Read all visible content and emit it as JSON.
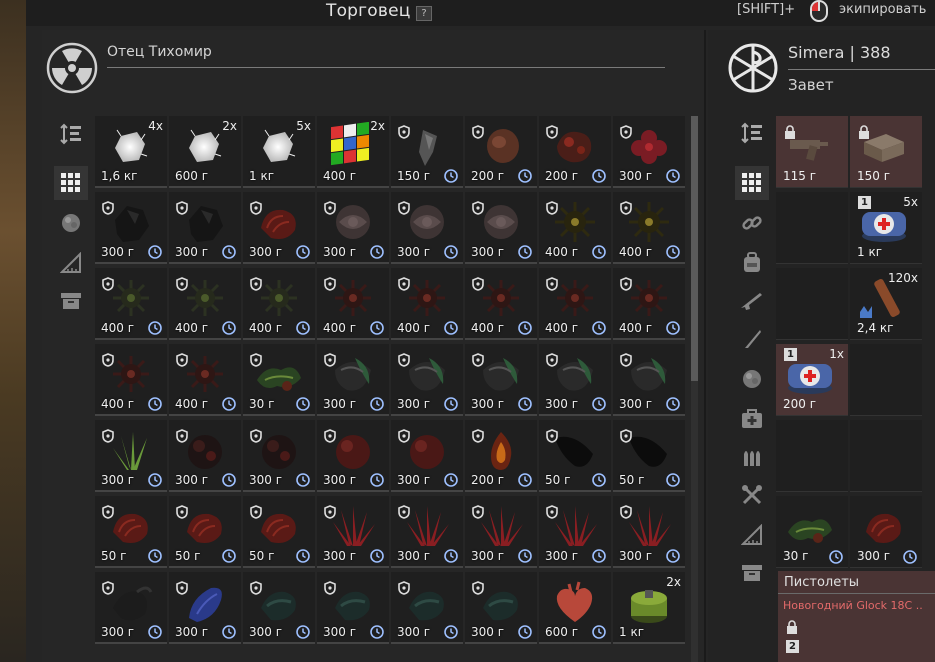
{
  "window": {
    "title": "Торговец",
    "help": "?",
    "hint_key": "[SHIFT]+",
    "hint_action": "экипировать"
  },
  "trader": {
    "name": "Отец Тихомир",
    "icon": "radiation-icon"
  },
  "player": {
    "name": "Simera | 388",
    "faction": "Завет",
    "icon": "faction-emblem-icon"
  },
  "left_tabs": [
    {
      "name": "sort-icon",
      "active": false
    },
    {
      "name": "grid-icon",
      "active": true
    },
    {
      "name": "artifact-icon",
      "active": false
    },
    {
      "name": "ruler-icon",
      "active": false
    },
    {
      "name": "box-icon",
      "active": false
    }
  ],
  "right_tabs": [
    {
      "name": "sort-icon",
      "active": false
    },
    {
      "name": "grid-icon",
      "active": true
    },
    {
      "name": "link-icon",
      "active": false
    },
    {
      "name": "backpack-icon",
      "active": false
    },
    {
      "name": "rifle-icon",
      "active": false
    },
    {
      "name": "knife-icon",
      "active": false
    },
    {
      "name": "artifact-icon",
      "active": false
    },
    {
      "name": "medkit-icon",
      "active": false
    },
    {
      "name": "ammo-icon",
      "active": false
    },
    {
      "name": "tools-icon",
      "active": false
    },
    {
      "name": "ruler-icon",
      "active": false
    },
    {
      "name": "box-icon",
      "active": false
    }
  ],
  "trader_items": [
    [
      {
        "kind": "crystal-white",
        "qty": "4x",
        "weight": "1,6 кг",
        "shield": false,
        "clock": false
      },
      {
        "kind": "crystal-white",
        "qty": "2x",
        "weight": "600 г",
        "shield": false,
        "clock": false
      },
      {
        "kind": "crystal-white",
        "qty": "5x",
        "weight": "1 кг",
        "shield": false,
        "clock": false
      },
      {
        "kind": "rubik-cube",
        "qty": "2x",
        "weight": "400 г",
        "shield": false,
        "clock": false
      },
      {
        "kind": "gray-shard",
        "qty": "",
        "weight": "150 г",
        "shield": true,
        "clock": true
      },
      {
        "kind": "brown-lump",
        "qty": "",
        "weight": "200 г",
        "shield": true,
        "clock": true
      },
      {
        "kind": "red-lump",
        "qty": "",
        "weight": "200 г",
        "shield": true,
        "clock": true
      },
      {
        "kind": "red-flower",
        "qty": "",
        "weight": "300 г",
        "shield": true,
        "clock": true
      }
    ],
    [
      {
        "kind": "black-rock",
        "qty": "",
        "weight": "300 г",
        "shield": true,
        "clock": true
      },
      {
        "kind": "black-rock",
        "qty": "",
        "weight": "300 г",
        "shield": true,
        "clock": true
      },
      {
        "kind": "red-shell",
        "qty": "",
        "weight": "300 г",
        "shield": true,
        "clock": true
      },
      {
        "kind": "gray-rose",
        "qty": "",
        "weight": "300 г",
        "shield": true,
        "clock": true
      },
      {
        "kind": "gray-rose",
        "qty": "",
        "weight": "300 г",
        "shield": true,
        "clock": true
      },
      {
        "kind": "gray-rose",
        "qty": "",
        "weight": "300 г",
        "shield": true,
        "clock": true
      },
      {
        "kind": "spiky-mine",
        "qty": "",
        "weight": "400 г",
        "shield": true,
        "clock": true
      },
      {
        "kind": "spiky-mine",
        "qty": "",
        "weight": "400 г",
        "shield": true,
        "clock": true
      }
    ],
    [
      {
        "kind": "spiky-green",
        "qty": "",
        "weight": "400 г",
        "shield": true,
        "clock": true
      },
      {
        "kind": "spiky-green",
        "qty": "",
        "weight": "400 г",
        "shield": true,
        "clock": true
      },
      {
        "kind": "spiky-green",
        "qty": "",
        "weight": "400 г",
        "shield": true,
        "clock": true
      },
      {
        "kind": "spiky-red",
        "qty": "",
        "weight": "400 г",
        "shield": true,
        "clock": true
      },
      {
        "kind": "spiky-red",
        "qty": "",
        "weight": "400 г",
        "shield": true,
        "clock": true
      },
      {
        "kind": "spiky-red",
        "qty": "",
        "weight": "400 г",
        "shield": true,
        "clock": true
      },
      {
        "kind": "spiky-red",
        "qty": "",
        "weight": "400 г",
        "shield": true,
        "clock": true
      },
      {
        "kind": "spiky-red",
        "qty": "",
        "weight": "400 г",
        "shield": true,
        "clock": true
      }
    ],
    [
      {
        "kind": "spiky-red",
        "qty": "",
        "weight": "400 г",
        "shield": true,
        "clock": true
      },
      {
        "kind": "spiky-red",
        "qty": "",
        "weight": "400 г",
        "shield": true,
        "clock": true
      },
      {
        "kind": "green-leaf",
        "qty": "",
        "weight": "30 г",
        "shield": true,
        "clock": true
      },
      {
        "kind": "green-shell",
        "qty": "",
        "weight": "300 г",
        "shield": true,
        "clock": true
      },
      {
        "kind": "green-shell",
        "qty": "",
        "weight": "300 г",
        "shield": true,
        "clock": true
      },
      {
        "kind": "green-shell",
        "qty": "",
        "weight": "300 г",
        "shield": true,
        "clock": true
      },
      {
        "kind": "green-shell",
        "qty": "",
        "weight": "300 г",
        "shield": true,
        "clock": true
      },
      {
        "kind": "green-shell",
        "qty": "",
        "weight": "300 г",
        "shield": true,
        "clock": true
      }
    ],
    [
      {
        "kind": "green-grass",
        "qty": "",
        "weight": "300 г",
        "shield": true,
        "clock": true
      },
      {
        "kind": "red-black-orb",
        "qty": "",
        "weight": "300 г",
        "shield": true,
        "clock": true
      },
      {
        "kind": "red-black-orb",
        "qty": "",
        "weight": "300 г",
        "shield": true,
        "clock": true
      },
      {
        "kind": "red-orb",
        "qty": "",
        "weight": "300 г",
        "shield": true,
        "clock": true
      },
      {
        "kind": "red-orb",
        "qty": "",
        "weight": "300 г",
        "shield": true,
        "clock": true
      },
      {
        "kind": "fire-orb",
        "qty": "",
        "weight": "200 г",
        "shield": true,
        "clock": true
      },
      {
        "kind": "black-feather",
        "qty": "",
        "weight": "50 г",
        "shield": true,
        "clock": true
      },
      {
        "kind": "black-feather",
        "qty": "",
        "weight": "50 г",
        "shield": true,
        "clock": true
      }
    ],
    [
      {
        "kind": "red-shell",
        "qty": "",
        "weight": "50 г",
        "shield": true,
        "clock": true
      },
      {
        "kind": "red-shell",
        "qty": "",
        "weight": "50 г",
        "shield": true,
        "clock": true
      },
      {
        "kind": "red-shell",
        "qty": "",
        "weight": "50 г",
        "shield": true,
        "clock": true
      },
      {
        "kind": "red-crystal",
        "qty": "",
        "weight": "300 г",
        "shield": true,
        "clock": true
      },
      {
        "kind": "red-crystal",
        "qty": "",
        "weight": "300 г",
        "shield": true,
        "clock": true
      },
      {
        "kind": "red-crystal",
        "qty": "",
        "weight": "300 г",
        "shield": true,
        "clock": true
      },
      {
        "kind": "red-crystal",
        "qty": "",
        "weight": "300 г",
        "shield": true,
        "clock": true
      },
      {
        "kind": "red-crystal",
        "qty": "",
        "weight": "300 г",
        "shield": true,
        "clock": true
      }
    ],
    [
      {
        "kind": "dark-claw",
        "qty": "",
        "weight": "300 г",
        "shield": true,
        "clock": true
      },
      {
        "kind": "blue-claw",
        "qty": "",
        "weight": "300 г",
        "shield": true,
        "clock": true
      },
      {
        "kind": "teal-claw",
        "qty": "",
        "weight": "300 г",
        "shield": true,
        "clock": true
      },
      {
        "kind": "teal-claw",
        "qty": "",
        "weight": "300 г",
        "shield": true,
        "clock": true
      },
      {
        "kind": "teal-claw",
        "qty": "",
        "weight": "300 г",
        "shield": true,
        "clock": true
      },
      {
        "kind": "teal-claw",
        "qty": "",
        "weight": "300 г",
        "shield": true,
        "clock": true
      },
      {
        "kind": "heart",
        "qty": "",
        "weight": "600 г",
        "shield": false,
        "clock": true
      },
      {
        "kind": "green-canister",
        "qty": "2x",
        "weight": "1 кг",
        "shield": false,
        "clock": false
      }
    ]
  ],
  "player_items": [
    {
      "row": 0,
      "col": 0,
      "kind": "pistol-parts",
      "weight": "115 г",
      "qty": "",
      "locked": true,
      "badge": "",
      "clock": false,
      "tint": true
    },
    {
      "row": 0,
      "col": 1,
      "kind": "box-parts",
      "weight": "150 г",
      "qty": "",
      "locked": true,
      "badge": "",
      "clock": false,
      "tint": true
    },
    {
      "row": 1,
      "col": 0,
      "kind": "empty",
      "weight": "",
      "qty": "",
      "locked": false,
      "badge": "",
      "clock": false,
      "tint": false
    },
    {
      "row": 1,
      "col": 1,
      "kind": "medkit",
      "weight": "1 кг",
      "qty": "5x",
      "locked": false,
      "badge": "1",
      "clock": false,
      "tint": false
    },
    {
      "row": 2,
      "col": 0,
      "kind": "empty",
      "weight": "",
      "qty": "",
      "locked": false,
      "badge": "",
      "clock": false,
      "tint": false
    },
    {
      "row": 2,
      "col": 1,
      "kind": "ammo-box",
      "weight": "2,4 кг",
      "qty": "120x",
      "locked": false,
      "badge": "",
      "clock": false,
      "tint": false
    },
    {
      "row": 3,
      "col": 0,
      "kind": "medkit",
      "weight": "200 г",
      "qty": "1x",
      "locked": false,
      "badge": "1",
      "clock": false,
      "tint": true
    },
    {
      "row": 3,
      "col": 1,
      "kind": "empty",
      "weight": "",
      "qty": "",
      "locked": false,
      "badge": "",
      "clock": false,
      "tint": false
    },
    {
      "row": 4,
      "col": 0,
      "kind": "empty",
      "weight": "",
      "qty": "",
      "locked": false,
      "badge": "",
      "clock": false,
      "tint": false
    },
    {
      "row": 4,
      "col": 1,
      "kind": "empty",
      "weight": "",
      "qty": "",
      "locked": false,
      "badge": "",
      "clock": false,
      "tint": false
    },
    {
      "row": 5,
      "col": 0,
      "kind": "green-leaf",
      "weight": "30 г",
      "qty": "",
      "locked": false,
      "badge": "",
      "clock": true,
      "tint": false
    },
    {
      "row": 5,
      "col": 1,
      "kind": "red-shell",
      "weight": "300 г",
      "qty": "",
      "locked": false,
      "badge": "",
      "clock": true,
      "tint": false
    }
  ],
  "weapon_slot": {
    "category": "Пистолеты",
    "name": "Новогодний Glock 18C ..",
    "badge": "2"
  },
  "colors": {
    "accent_red": "#e36a6a",
    "locked_bg": "#4a3434"
  }
}
